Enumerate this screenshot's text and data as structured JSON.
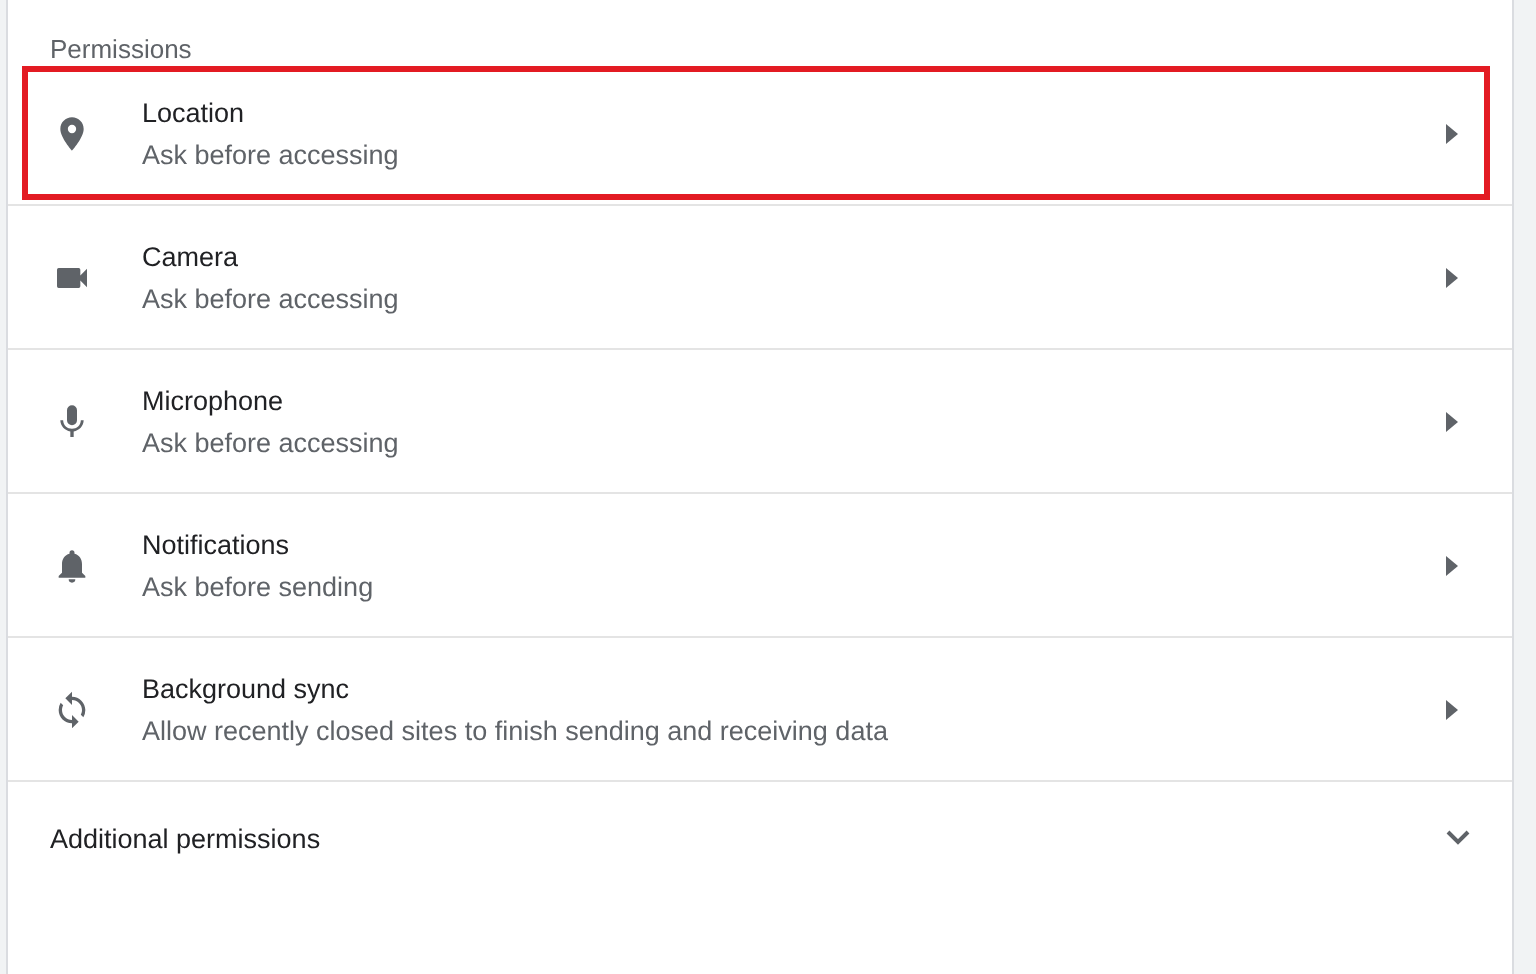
{
  "section_title": "Permissions",
  "rows": [
    {
      "kind": "pin",
      "title": "Location",
      "subtitle": "Ask before accessing",
      "highlighted": true
    },
    {
      "kind": "camera",
      "title": "Camera",
      "subtitle": "Ask before accessing",
      "highlighted": false
    },
    {
      "kind": "mic",
      "title": "Microphone",
      "subtitle": "Ask before accessing",
      "highlighted": false
    },
    {
      "kind": "bell",
      "title": "Notifications",
      "subtitle": "Ask before sending",
      "highlighted": false
    },
    {
      "kind": "sync",
      "title": "Background sync",
      "subtitle": "Allow recently closed sites to finish sending and receiving data",
      "highlighted": false
    }
  ],
  "additional": {
    "label": "Additional permissions",
    "expanded": false
  }
}
